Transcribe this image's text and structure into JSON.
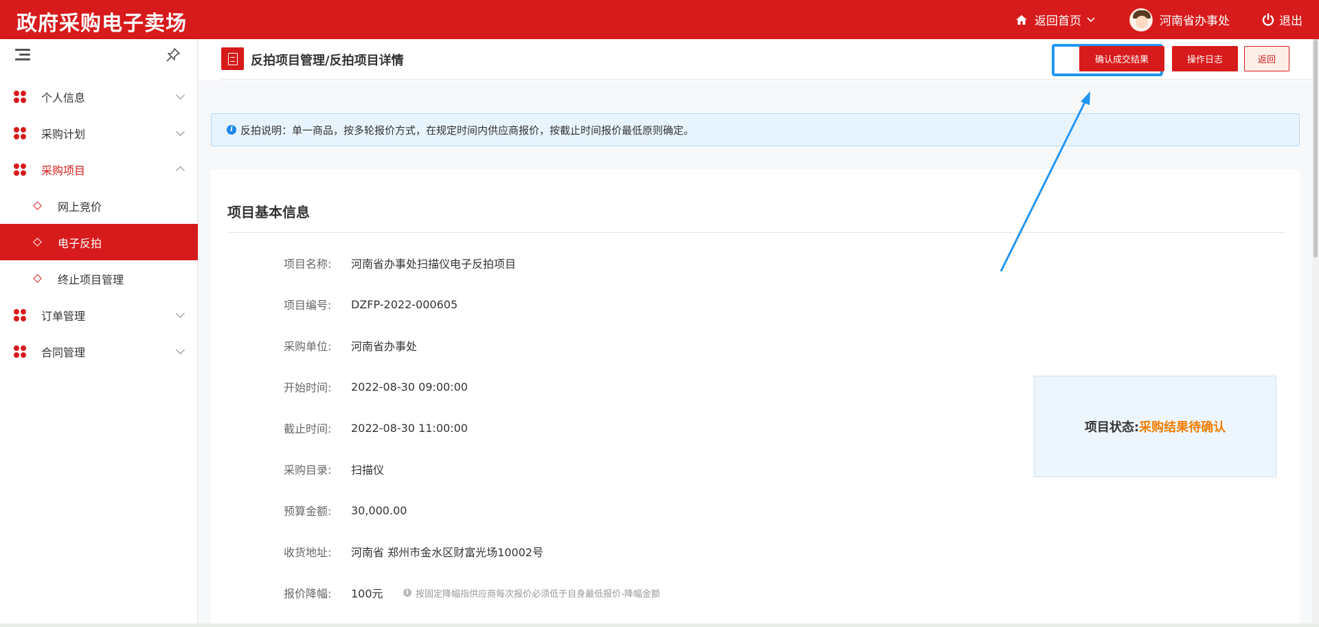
{
  "header": {
    "brand": "政府采购电子卖场",
    "home_label": "返回首页",
    "user_name": "河南省办事处",
    "logout_label": "退出"
  },
  "sidebar": {
    "items": [
      {
        "label": "个人信息"
      },
      {
        "label": "采购计划"
      },
      {
        "label": "采购项目"
      },
      {
        "label": "订单管理"
      },
      {
        "label": "合同管理"
      }
    ],
    "sub_items": [
      {
        "label": "网上竞价"
      },
      {
        "label": "电子反拍"
      },
      {
        "label": "终止项目管理"
      }
    ]
  },
  "page": {
    "breadcrumb": "反拍项目管理/反拍项目详情",
    "buttons": {
      "confirm": "确认成交结果",
      "log": "操作日志",
      "back": "返回"
    },
    "notice": "反拍说明：单一商品，按多轮报价方式，在规定时间内供应商报价，按截止时间报价最低原则确定。",
    "section_title": "项目基本信息",
    "fields": [
      {
        "key": "项目名称:",
        "value": "河南省办事处扫描仪电子反拍项目"
      },
      {
        "key": "项目编号:",
        "value": "DZFP-2022-000605"
      },
      {
        "key": "采购单位:",
        "value": "河南省办事处"
      },
      {
        "key": "开始时间:",
        "value": "2022-08-30 09:00:00"
      },
      {
        "key": "截止时间:",
        "value": "2022-08-30 11:00:00"
      },
      {
        "key": "采购目录:",
        "value": "扫描仪"
      },
      {
        "key": "预算金额:",
        "value": "30,000.00"
      },
      {
        "key": "收货地址:",
        "value": "河南省 郑州市金水区财富光场10002号"
      },
      {
        "key": "报价降幅:",
        "value": "100元",
        "hint": "按固定降幅指供应商每次报价必须低于自身最低报价-降幅金额"
      }
    ],
    "status": {
      "key": "项目状态:",
      "value": "采购结果待确认"
    }
  },
  "colors": {
    "brand_red": "#d71a1b",
    "status_orange": "#f57c00",
    "annotation_blue": "#2196f3"
  }
}
